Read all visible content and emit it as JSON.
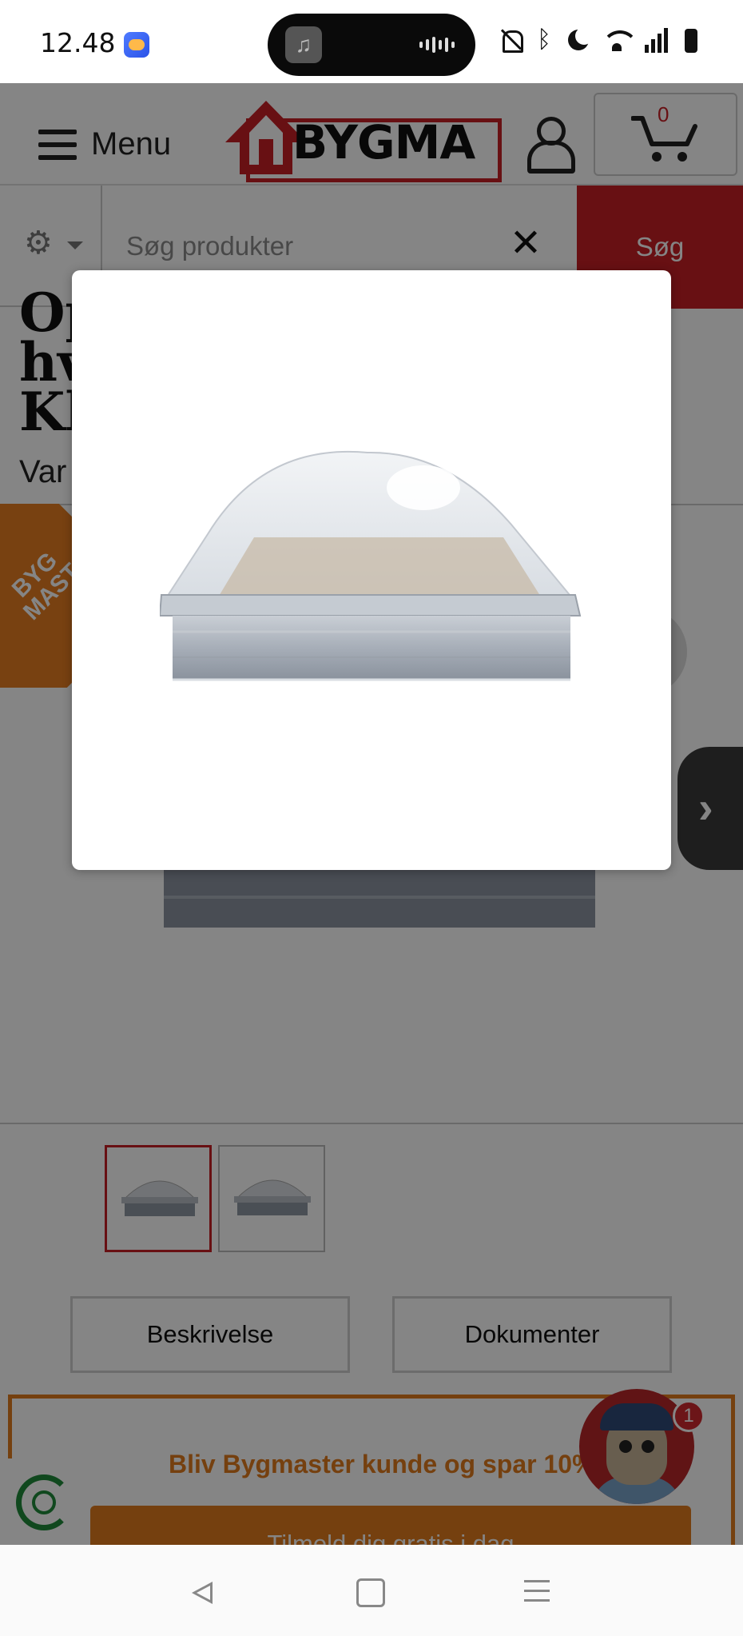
{
  "status_bar": {
    "time": "12.48",
    "icons": [
      "calendar-app-icon",
      "music-icon",
      "audio-wave-icon",
      "muted-bell-icon",
      "bluetooth-icon",
      "moon-icon",
      "wifi-icon",
      "signal-icon",
      "battery-icon"
    ]
  },
  "header": {
    "menu_label": "Menu",
    "logo_text": "BYGMA",
    "cart_count": "0"
  },
  "search": {
    "placeholder": "Søg produkter",
    "clear_symbol": "✕",
    "button_label": "Søg"
  },
  "product": {
    "title_fragment": "Op\nhv\nKl",
    "variant_fragment": "Var",
    "badge_text": "BYG\nMAST"
  },
  "gallery": {
    "thumbnail_count": 2,
    "active_index": 0,
    "next_icon": "chevron-right-icon"
  },
  "tabs": [
    "Beskrivelse",
    "Dokumenter"
  ],
  "promo": {
    "text": "Bliv Bygmaster kunde og spar 10%",
    "cta": "Tilmeld dig gratis i dag"
  },
  "chat": {
    "notification_count": "1"
  },
  "modal": {
    "image_subject": "skylight-dome-icon"
  },
  "navbar": {
    "buttons": [
      "back-icon",
      "home-icon",
      "recents-icon"
    ]
  },
  "colors": {
    "brand_red": "#c71f25",
    "promo_orange": "#e07b1d",
    "overlay": "rgba(0,0,0,0.48)"
  }
}
